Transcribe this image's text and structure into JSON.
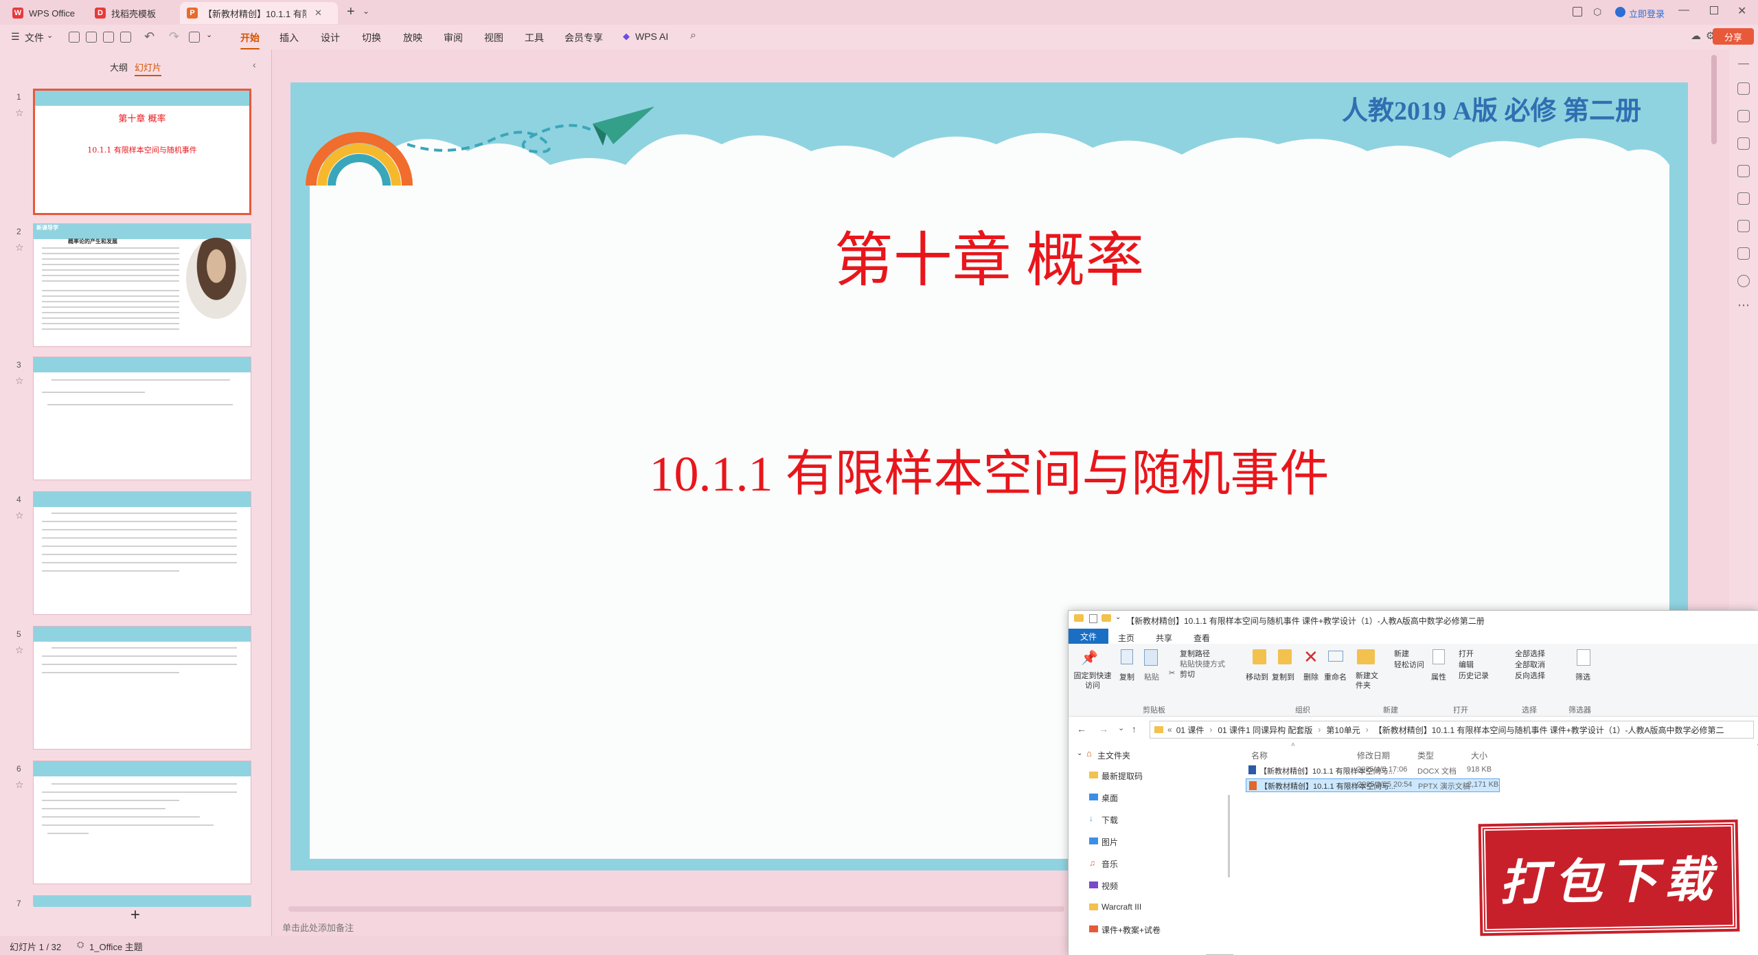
{
  "tabs": [
    {
      "label": "WPS Office",
      "icon": "wps-logo-icon"
    },
    {
      "label": "找稻壳模板",
      "icon": "docer-icon"
    },
    {
      "label": "【新教材精创】10.1.1 有限样",
      "icon": "ppt-file-icon"
    }
  ],
  "window": {
    "login": "立即登录"
  },
  "ribbon": {
    "file": "文件",
    "menus": [
      "开始",
      "插入",
      "设计",
      "切换",
      "放映",
      "审阅",
      "视图",
      "工具",
      "会员专享"
    ],
    "ai": "WPS AI",
    "share": "分享"
  },
  "panel": {
    "tab_outline": "大纲",
    "tab_slides": "幻灯片"
  },
  "thumbs": [
    {
      "num": "1",
      "title": "第十章 概率",
      "subtitle": "10.1.1 有限样本空间与随机事件"
    },
    {
      "num": "2",
      "header": "新课导学",
      "title": "概率论的产生和发展"
    },
    {
      "num": "3"
    },
    {
      "num": "4"
    },
    {
      "num": "5"
    },
    {
      "num": "6"
    },
    {
      "num": "7"
    }
  ],
  "slide": {
    "edition": "人教2019 A版 必修 第二册",
    "chapter": "第十章 概率",
    "section": "10.1.1 有限样本空间与随机事件"
  },
  "notes_placeholder": "单击此处添加备注",
  "status": {
    "slide_count": "幻灯片 1 / 32",
    "theme": "1_Office 主题"
  },
  "explorer": {
    "title": "【新教材精创】10.1.1 有限样本空间与随机事件 课件+教学设计（1）-人教A版高中数学必修第二册",
    "tabs": [
      "文件",
      "主页",
      "共享",
      "查看"
    ],
    "groups": [
      "剪贴板",
      "组织",
      "新建",
      "打开",
      "选择"
    ],
    "buttons": {
      "pin": "固定到快速访问",
      "copy": "复制",
      "paste": "粘贴",
      "copy_path": "复制路径",
      "paste_shortcut": "粘贴快捷方式",
      "cut": "剪切",
      "move_to": "移动到",
      "copy_to": "复制到",
      "delete": "删除",
      "rename": "重命名",
      "new_folder": "新建文件夹",
      "new_item": "新建",
      "easy_access": "轻松访问",
      "properties": "属性",
      "open": "打开",
      "edit": "编辑",
      "history": "历史记录",
      "select_all": "全部选择",
      "select_none": "全部取消",
      "invert": "反向选择"
    },
    "filter_group": "筛选器",
    "filter": "筛选",
    "path": [
      "01 课件",
      "01 课件1 同课异构 配套版",
      "第10单元",
      "【新教材精创】10.1.1 有限样本空间与随机事件 课件+教学设计（1）-人教A版高中数学必修第二"
    ],
    "columns": [
      "名称",
      "修改日期",
      "类型",
      "大小"
    ],
    "nav": [
      "主文件夹",
      "最新提取码",
      "桌面",
      "下载",
      "图片",
      "音乐",
      "视频",
      "Warcraft III",
      "课件+教案+试卷"
    ],
    "files": [
      {
        "name": "【新教材精创】10.1.1 有限样本空间与...",
        "date": "2025/4/3 17:06",
        "type": "DOCX 文档",
        "size": "918 KB"
      },
      {
        "name": "【新教材精创】10.1.1 有限样本空间与...",
        "date": "2025/3/25 20:54",
        "type": "PPTX 演示文稿",
        "size": "2,171 KB"
      }
    ]
  },
  "stamp": "打包下载",
  "colors": {
    "accent": "#d35400",
    "slide_title": "#e8161b",
    "edition": "#2f6fb1",
    "slide_bg": "#8fd3e0"
  }
}
